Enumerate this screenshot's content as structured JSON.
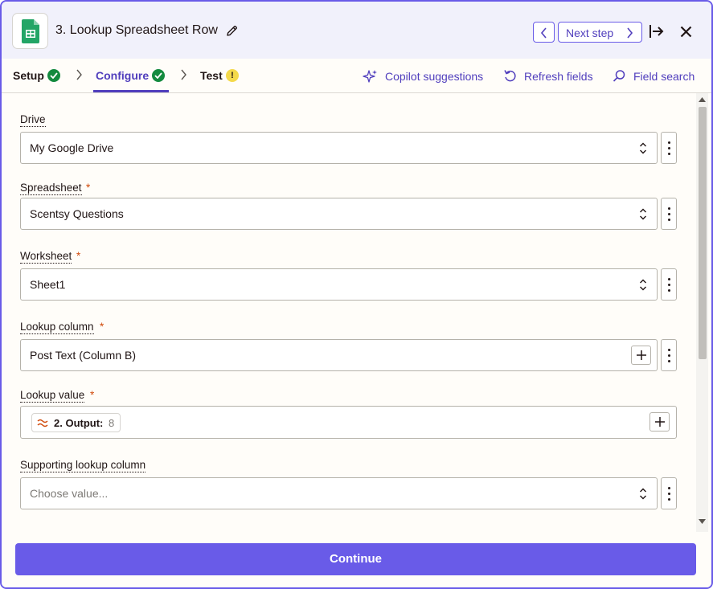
{
  "header": {
    "title": "3. Lookup Spreadsheet Row",
    "next_step_label": "Next step"
  },
  "tabs": [
    {
      "label": "Setup",
      "status": "complete"
    },
    {
      "label": "Configure",
      "status": "complete",
      "active": true
    },
    {
      "label": "Test",
      "status": "warning",
      "badge": "!"
    }
  ],
  "tools": {
    "copilot": "Copilot suggestions",
    "refresh": "Refresh fields",
    "search": "Field search"
  },
  "fields": {
    "drive": {
      "label": "Drive",
      "value": "My Google Drive"
    },
    "spreadsheet": {
      "label": "Spreadsheet",
      "required": "*",
      "value": "Scentsy Questions"
    },
    "worksheet": {
      "label": "Worksheet",
      "required": "*",
      "value": "Sheet1"
    },
    "lookup_column": {
      "label": "Lookup column",
      "required": "*",
      "value": "Post Text (Column B)"
    },
    "lookup_value": {
      "label": "Lookup value",
      "required": "*",
      "pill_label": "2. Output:",
      "pill_value": "8"
    },
    "supporting_column": {
      "label": "Supporting lookup column",
      "placeholder": "Choose value..."
    }
  },
  "footer": {
    "continue_label": "Continue"
  },
  "colors": {
    "accent": "#695be8",
    "accent_text": "#503ebd",
    "success": "#138a3e",
    "warning": "#f4d94b",
    "required": "#d14b0c"
  }
}
